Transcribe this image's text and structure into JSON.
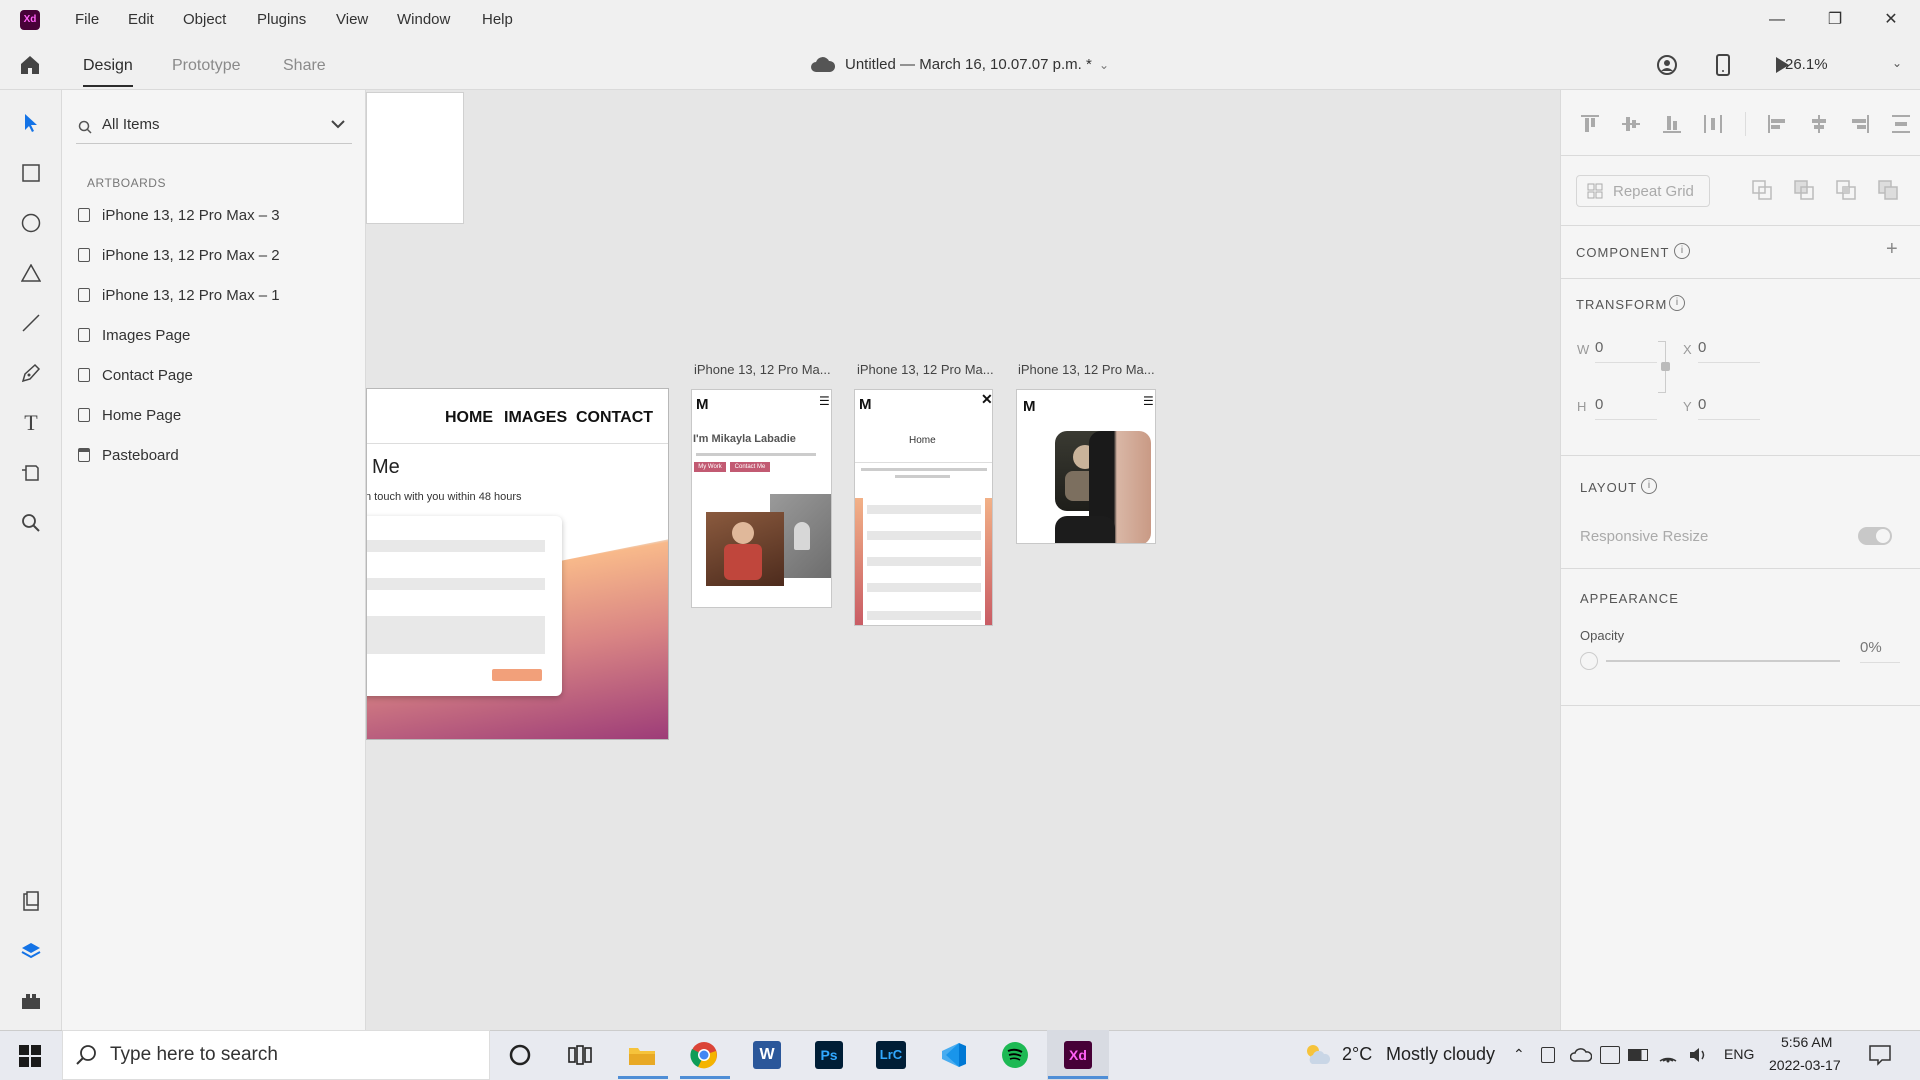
{
  "titlebar": {
    "logo": "Xd",
    "menus": [
      "File",
      "Edit",
      "Object",
      "Plugins",
      "View",
      "Window",
      "Help"
    ]
  },
  "toolbar": {
    "tabs": [
      "Design",
      "Prototype",
      "Share"
    ],
    "doc_title": "Untitled — March 16, 10.07.07 p.m. *",
    "zoom": "26.1%"
  },
  "layers": {
    "search_placeholder": "All Items",
    "section": "ARTBOARDS",
    "items": [
      "iPhone 13, 12 Pro Max – 3",
      "iPhone 13, 12 Pro Max – 2",
      "iPhone 13, 12 Pro Max – 1",
      "Images Page",
      "Contact Page",
      "Home Page",
      "Pasteboard"
    ]
  },
  "canvas": {
    "artboard_labels": [
      "iPhone 13, 12 Pro Ma...",
      "iPhone 13, 12 Pro Ma...",
      "iPhone 13, 12 Pro Ma..."
    ],
    "contact_nav": [
      "HOME",
      "IMAGES",
      "CONTACT"
    ],
    "contact_title": "Me",
    "contact_sub": "n touch with you within 48 hours",
    "phone1_name": "I'm Mikayla Labadie",
    "phone1_btn1": "My Work",
    "phone1_btn2": "Contact Me",
    "phone2_title": "Home",
    "logo_letter": "M"
  },
  "inspector": {
    "repeat_grid": "Repeat Grid",
    "component": "COMPONENT",
    "transform": "TRANSFORM",
    "w_label": "W",
    "w_val": "0",
    "x_label": "X",
    "x_val": "0",
    "h_label": "H",
    "h_val": "0",
    "y_label": "Y",
    "y_val": "0",
    "layout": "LAYOUT",
    "responsive_resize": "Responsive Resize",
    "appearance": "APPEARANCE",
    "opacity_label": "Opacity",
    "opacity_val": "0%"
  },
  "taskbar": {
    "search_placeholder": "Type here to search",
    "weather_temp": "2°C",
    "weather_desc": "Mostly cloudy",
    "lang": "ENG",
    "time": "5:56 AM",
    "date": "2022-03-17",
    "apps": [
      "cortana-icon",
      "task-view-icon",
      "file-explorer-icon",
      "chrome-icon",
      "word-icon",
      "photoshop-icon",
      "lightroom-classic-icon",
      "vscode-icon",
      "spotify-icon",
      "adobe-xd-icon"
    ],
    "app_labels": {
      "word": "W",
      "photoshop": "Ps",
      "lightroom": "LrC",
      "xd": "Xd"
    }
  },
  "colors": {
    "xd_brand": "#470137",
    "xd_pink": "#ff61f6",
    "accent_blue": "#1473e6",
    "contact_gradient_top": "#f8b98a",
    "contact_gradient_bottom": "#9c3b78"
  }
}
